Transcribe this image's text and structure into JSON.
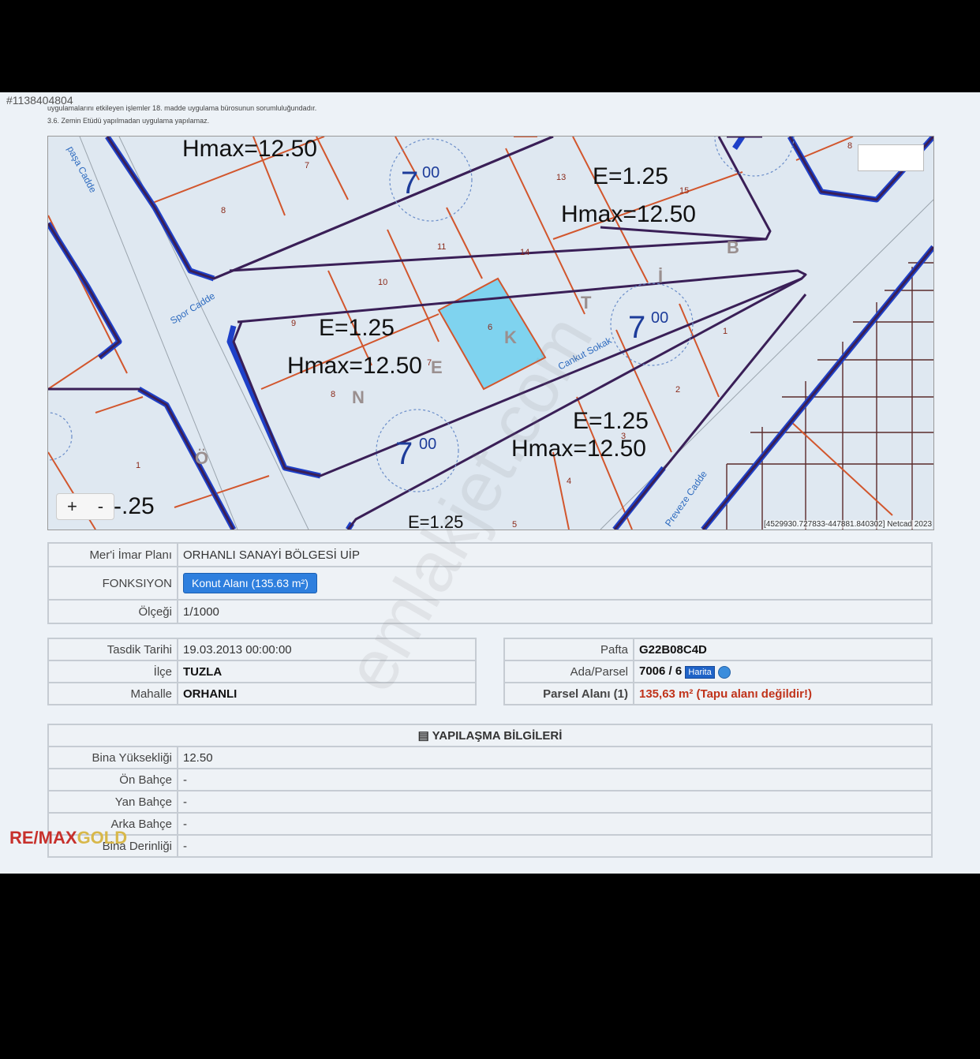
{
  "listing_id": "#1138404804",
  "notes": [
    "uygulamalarını etkileyen işlemler 18. madde uygulama bürosunun sorumluluğundadır.",
    "3.6. Zemin Etüdü yapılmadan uygulama yapılamaz."
  ],
  "map": {
    "labels": {
      "hmax_1": "Hmax=12.50",
      "e_2": "E=1.25",
      "hmax_2": "Hmax=12.50",
      "e_3": "E=1.25",
      "hmax_3": "Hmax=12.50",
      "e_4": "E=1.25",
      "hmax_4": "Hmax=12.50",
      "e_5": "E=1.25",
      "partial": "-.25"
    },
    "parcels": [
      "7",
      "8",
      "13",
      "15",
      "11",
      "14",
      "10",
      "9",
      "6",
      "1",
      "2",
      "3",
      "4",
      "5",
      "8",
      "8",
      "1",
      "7"
    ],
    "streets": {
      "spor": "Spor Cadde",
      "pasa": "paşa Cadde",
      "cankut": "Cankut Sokak",
      "preveze": "Preveze Cadde"
    },
    "letters": [
      "E",
      "K",
      "T",
      "İ",
      "B",
      "N",
      "Ö"
    ],
    "zone_main": "7",
    "zone_sup": "00",
    "zoom_in": "+",
    "zoom_out": "-",
    "coordinates": "[4529930.727833-447881.840302] Netcad 2023",
    "watermark": "emlakjet.com"
  },
  "plan": {
    "label_1": "Mer'i İmar Planı",
    "value_1": "ORHANLI SANAYİ BÖLGESİ UİP",
    "label_2": "FONKSIYON",
    "value_2": "Konut Alanı (135.63 m²)",
    "label_3": "Ölçeği",
    "value_3": "1/1000"
  },
  "left_table": {
    "tasdik_label": "Tasdik Tarihi",
    "tasdik_value": "19.03.2013 00:00:00",
    "ilce_label": "İlçe",
    "ilce_value": "TUZLA",
    "mahalle_label": "Mahalle",
    "mahalle_value": "ORHANLI"
  },
  "right_table": {
    "pafta_label": "Pafta",
    "pafta_value": "G22B08C4D",
    "ada_label": "Ada/Parsel",
    "ada_value": "7006 / 6",
    "harita_button": "Harita",
    "parsel_label": "Parsel Alanı (1)",
    "parsel_value": "135,63 m² (Tapu alanı değildir!)"
  },
  "yapilasma": {
    "header": "YAPILAŞMA BİLGİLERİ",
    "rows": [
      {
        "label": "Bina Yüksekliği",
        "value": "12.50"
      },
      {
        "label": "Ön Bahçe",
        "value": "-"
      },
      {
        "label": "Yan Bahçe",
        "value": "-"
      },
      {
        "label": "Arka Bahçe",
        "value": "-"
      },
      {
        "label": "Bina Derinliği",
        "value": "-"
      }
    ]
  },
  "brand": {
    "part1": "RE/MAX",
    "part2": "GOLD"
  },
  "colors": {
    "highlight": "#7fd3ef",
    "parcel_line": "#c0392b",
    "road_line": "#1e40c8",
    "dark_line": "#3a1f57"
  }
}
